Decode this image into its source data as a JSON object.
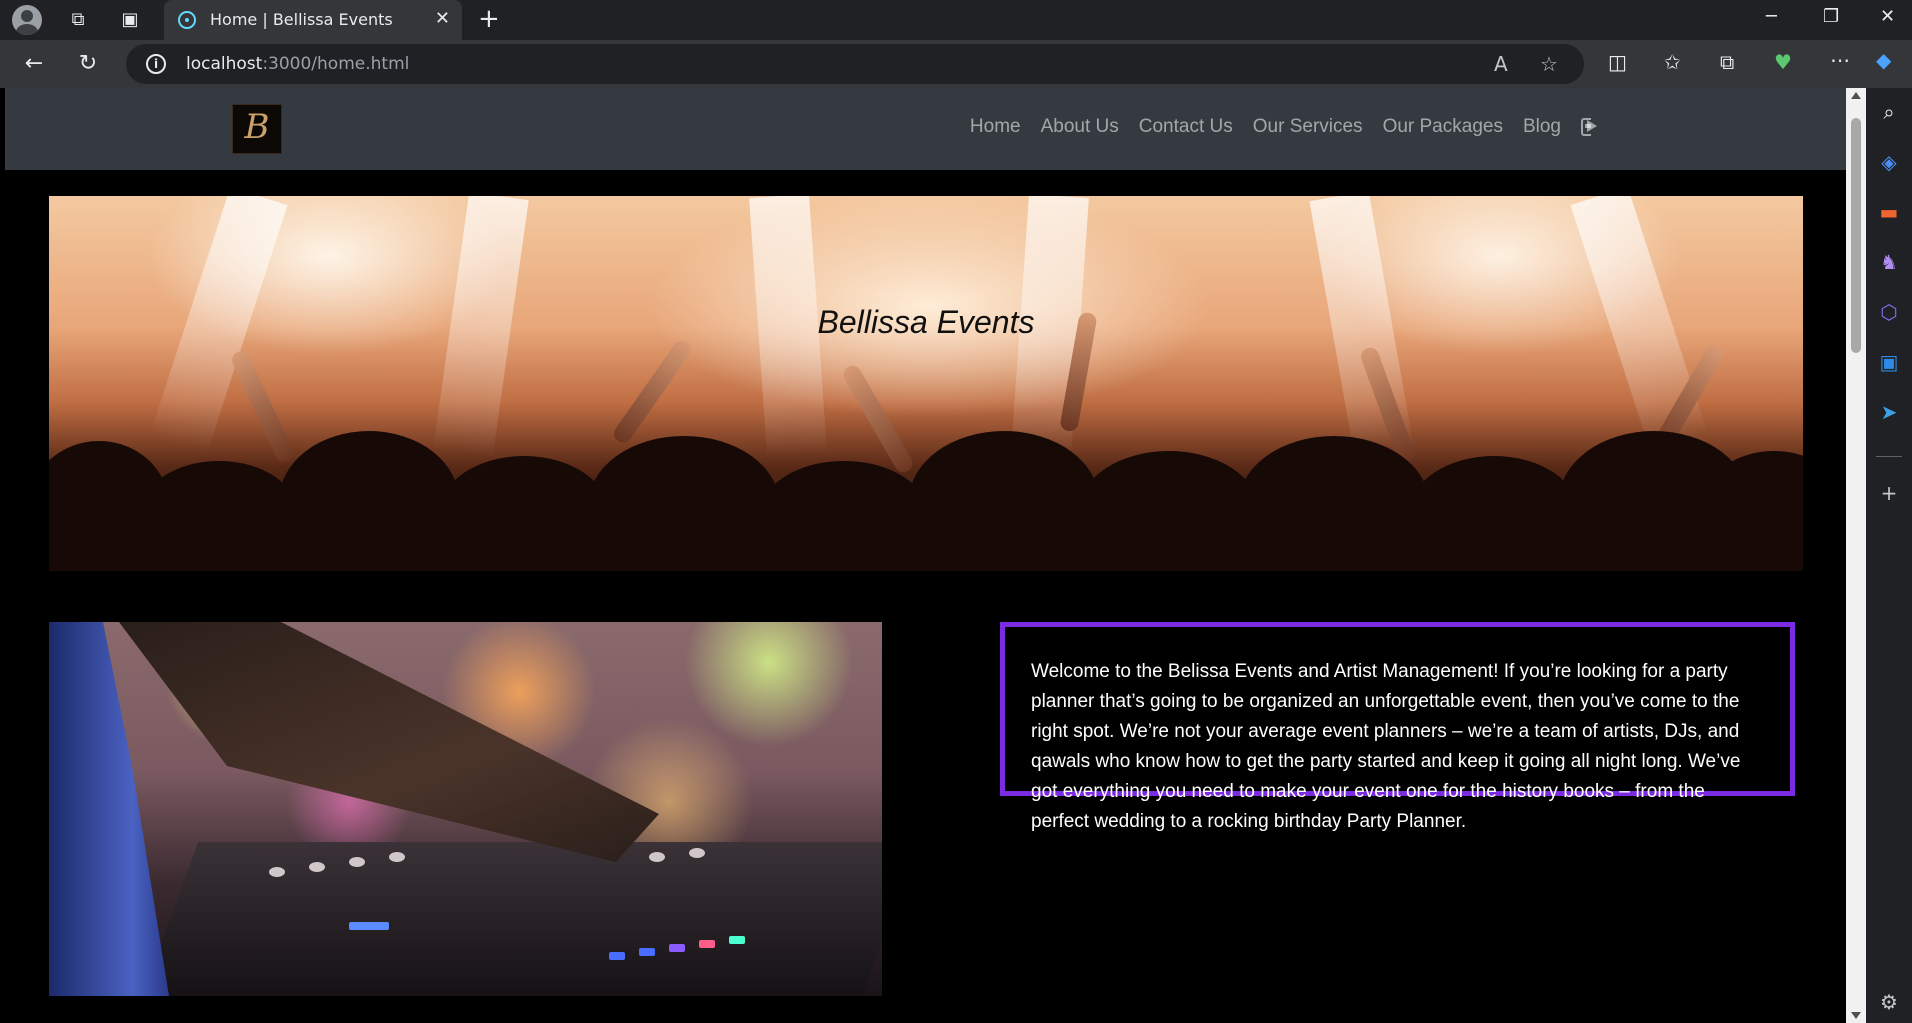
{
  "browser": {
    "tab": {
      "title": "Home | Bellissa Events",
      "favicon": "react-icon"
    },
    "url": {
      "host": "localhost",
      "path": ":3000/home.html"
    },
    "icons": {
      "profile": "profile-icon",
      "workspaces": "workspaces-icon",
      "tab_actions": "vertical-tabs-icon",
      "close_tab": "close-icon",
      "new_tab": "plus-icon",
      "back": "back-arrow-icon",
      "refresh": "refresh-icon",
      "site_info": "info-icon",
      "read_aloud": "read-aloud-icon",
      "favorite": "star-icon",
      "split_screen": "split-screen-icon",
      "favorites": "favorites-icon",
      "collections": "collections-icon",
      "browser_essentials": "heart-pulse-icon",
      "more": "more-icon",
      "copilot": "copilot-icon"
    },
    "window_controls": {
      "minimize": "─",
      "restore": "❐",
      "close": "✕"
    },
    "sidebar_icons": [
      "search-icon",
      "shopping-tag-icon",
      "tools-icon",
      "games-icon",
      "office-icon",
      "outlook-icon",
      "send-icon",
      "add-icon",
      "settings-icon"
    ]
  },
  "site": {
    "logo_letter": "B",
    "nav": {
      "items": [
        "Home",
        "About Us",
        "Contact Us",
        "Our Services",
        "Our Packages",
        "Blog"
      ],
      "logout_icon": "logout-icon"
    },
    "hero": {
      "title": "Bellissa Events"
    },
    "welcome": {
      "text": "Welcome to the Belissa Events and Artist Management! If you’re looking for a party planner that’s going to be organized an unforgettable event, then you’ve come to the right spot. We’re not your average event planners – we’re a team of artists, DJs, and qawals who know how to get the party started and keep it going all night long. We’ve got everything you need to make your event one for the history books – from the perfect wedding to a rocking birthday Party Planner."
    },
    "colors": {
      "navbar": "#343a40",
      "accent_border": "#7b2be2",
      "page_background": "#000000"
    }
  }
}
